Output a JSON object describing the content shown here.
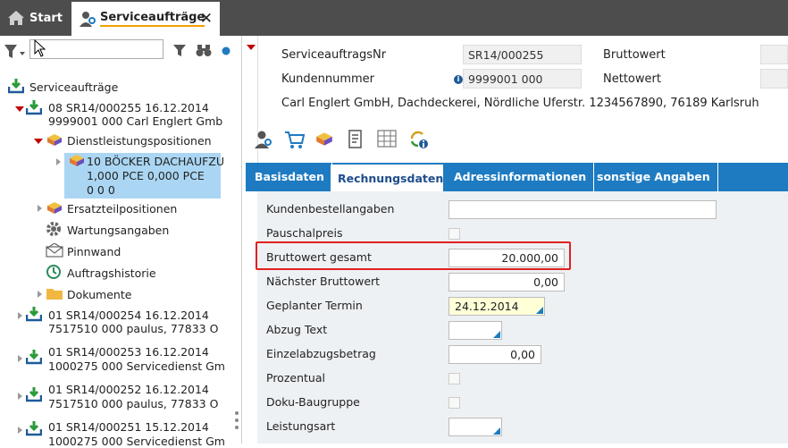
{
  "top_tabs": {
    "start": "Start",
    "active": "Serviceaufträge",
    "close": "✕"
  },
  "tree": {
    "root": "Serviceaufträge",
    "orders": [
      {
        "line1": "08 SR14/000255 16.12.2014",
        "line2": "9999001 000 Carl Englert Gmb"
      },
      {
        "line1": "01 SR14/000254 16.12.2014",
        "line2": "7517510 000 paulus, 77833 O"
      },
      {
        "line1": "01 SR14/000253 16.12.2014",
        "line2": "1000275 000 Servicedienst Gm"
      },
      {
        "line1": "01 SR14/000252 16.12.2014",
        "line2": "7517510 000 paulus, 77833 O"
      },
      {
        "line1": "01 SR14/000251 15.12.2014",
        "line2": "1000275 000 Servicedienst Gm"
      }
    ],
    "dienstleistung": "Dienstleistungspositionen",
    "position": {
      "line1": "10 BÖCKER DACHAUFZU",
      "line2": "1,000 PCE 0,000 PCE",
      "line3": "0 0 0"
    },
    "ersatzteil": "Ersatzteilpositionen",
    "wartung": "Wartungsangaben",
    "pinnwand": "Pinnwand",
    "historie": "Auftragshistorie",
    "dokumente": "Dokumente"
  },
  "header": {
    "nr_label": "ServiceauftragsNr",
    "nr_value": "SR14/000255",
    "kunde_label": "Kundennummer",
    "kunde_value": "9999001 000",
    "brutto_label": "Bruttowert",
    "netto_label": "Nettowert",
    "address": "Carl Englert GmbH, Dachdeckerei, Nördliche Uferstr. 1234567890, 76189 Karlsruh"
  },
  "tabs": [
    "Basisdaten",
    "Rechnungsdaten",
    "Adressinformationen",
    "sonstige Angaben"
  ],
  "form": {
    "kundenbestell_label": "Kundenbestellangaben",
    "kundenbestell_value": "",
    "pauschal_label": "Pauschalpreis",
    "brutto_gesamt_label": "Bruttowert gesamt",
    "brutto_gesamt_value": "20.000,00",
    "naechster_label": "Nächster Bruttowert",
    "naechster_value": "0,00",
    "termin_label": "Geplanter Termin",
    "termin_value": "24.12.2014",
    "abzug_text_label": "Abzug Text",
    "einzelabzug_label": "Einzelabzugsbetrag",
    "einzelabzug_value": "0,00",
    "prozentual_label": "Prozentual",
    "doku_label": "Doku-Baugruppe",
    "leistungsart_label": "Leistungsart"
  },
  "colors": {
    "accent": "#1e7bc1",
    "highlight": "#e02020",
    "selection": "#aad6f3"
  }
}
